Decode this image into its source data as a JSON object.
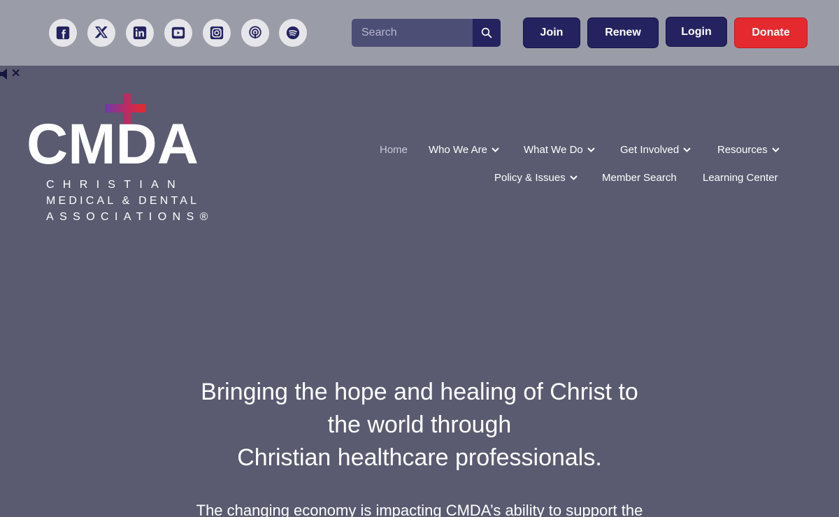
{
  "social": {
    "facebook": "facebook-icon",
    "x": "x-twitter-icon",
    "linkedin": "linkedin-icon",
    "youtube": "youtube-icon",
    "instagram": "instagram-icon",
    "podcast": "podcast-icon",
    "spotify": "spotify-icon"
  },
  "search": {
    "placeholder": "Search"
  },
  "top_buttons": {
    "join": "Join",
    "renew": "Renew",
    "login": "Login",
    "donate": "Donate"
  },
  "colors": {
    "topbar": "#9a9ca8",
    "page": "#5a5b70",
    "navy": "#24235f",
    "donate": "#e42a2f"
  },
  "logo": {
    "wordmark": "CMDA",
    "line1": "CHRISTIAN",
    "line2": "MEDICAL & DENTAL",
    "line3": "ASSOCIATIONS®"
  },
  "nav": {
    "home": "Home",
    "who_we_are": "Who We Are",
    "what_we_do": "What We Do",
    "get_involved": "Get Involved",
    "resources": "Resources",
    "policy": "Policy & Issues",
    "member_search": "Member Search",
    "learning_center": "Learning Center"
  },
  "hero": {
    "line1": "Bringing the hope and healing of Christ to",
    "line2": "the world through",
    "line3": "Christian healthcare professionals."
  },
  "body_text": "The changing economy is impacting CMDA’s ability to support the"
}
